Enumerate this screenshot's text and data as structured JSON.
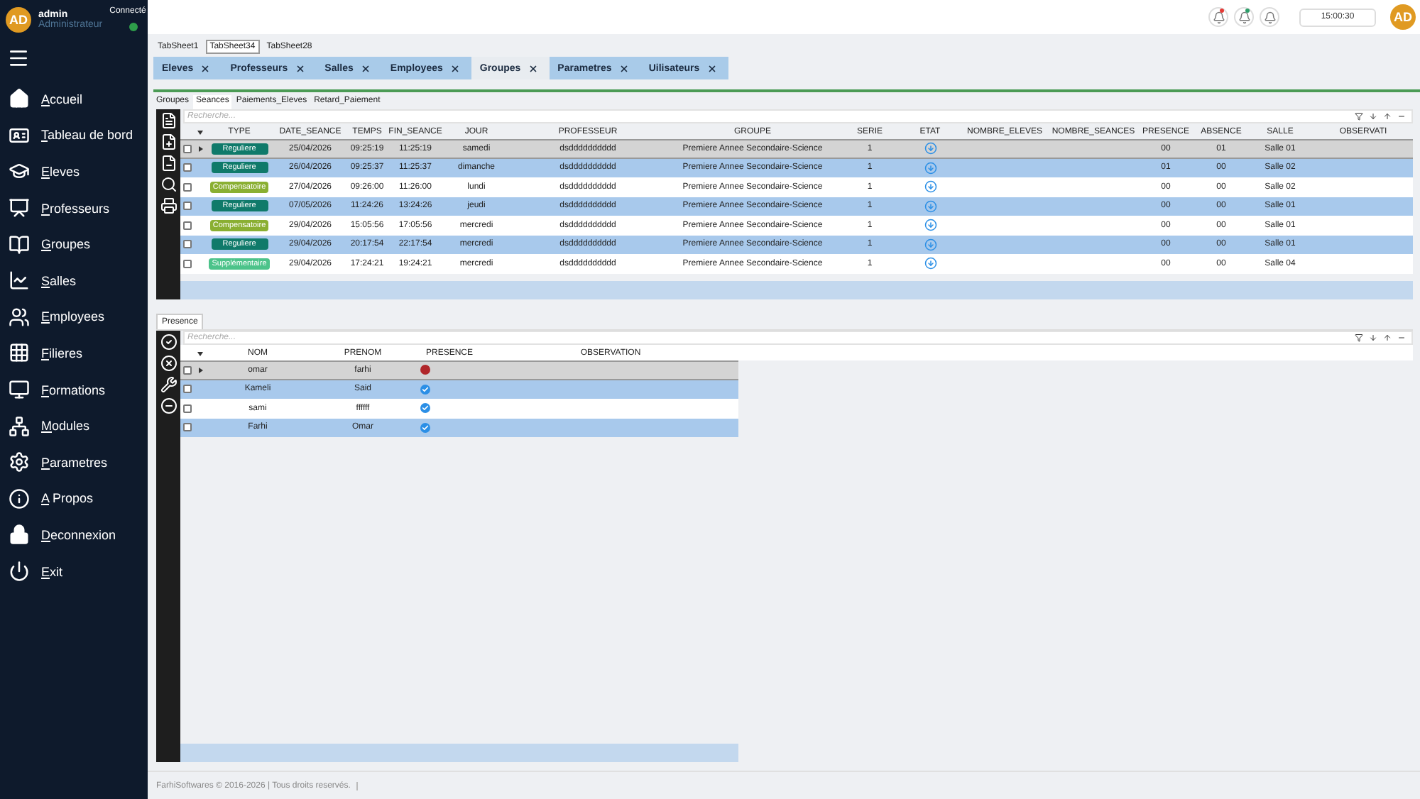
{
  "user": {
    "initials": "AD",
    "name": "admin",
    "role": "Administrateur",
    "status": "Connecté",
    "online": true
  },
  "menu": [
    {
      "label": "Accueil"
    },
    {
      "label": "Tableau de bord"
    },
    {
      "label": "Eleves"
    },
    {
      "label": "Professeurs"
    },
    {
      "label": "Groupes"
    },
    {
      "label": "Salles"
    },
    {
      "label": "Employees"
    },
    {
      "label": "Filieres"
    },
    {
      "label": "Formations"
    },
    {
      "label": "Modules"
    },
    {
      "label": "Parametres"
    },
    {
      "label": "A Propos"
    },
    {
      "label": "Deconnexion"
    },
    {
      "label": "Exit"
    }
  ],
  "topbar": {
    "notifications": [
      {
        "unread": true,
        "color": "#e53935"
      },
      {
        "unread": true,
        "color": "#2e9e6a"
      },
      {
        "unread": false
      }
    ],
    "time": "15:00:30",
    "avatar": "AD"
  },
  "sheet_tabs": [
    {
      "label": "TabSheet1",
      "selected": false
    },
    {
      "label": "TabSheet34",
      "selected": true
    },
    {
      "label": "TabSheet28",
      "selected": false
    }
  ],
  "doc_tabs": [
    {
      "label": "Eleves",
      "selected": false
    },
    {
      "label": "Professeurs",
      "selected": false
    },
    {
      "label": "Salles",
      "selected": false
    },
    {
      "label": "Employees",
      "selected": false
    },
    {
      "label": "Groupes",
      "selected": true
    },
    {
      "label": "Parametres",
      "selected": false
    },
    {
      "label": "Uilisateurs",
      "selected": false
    }
  ],
  "sub_tabs": [
    {
      "label": "Groupes",
      "selected": false
    },
    {
      "label": "Seances",
      "selected": true
    },
    {
      "label": "Paiements_Eleves",
      "selected": false
    },
    {
      "label": "Retard_Paiement",
      "selected": false
    }
  ],
  "seances": {
    "search": {
      "placeholder": "Recherche..."
    },
    "columns": [
      "TYPE",
      "DATE_SEANCE",
      "TEMPS",
      "FIN_SEANCE",
      "JOUR",
      "PROFESSEUR",
      "GROUPE",
      "SERIE",
      "ETAT",
      "NOMBRE_ELEVES",
      "NOMBRE_SEANCES",
      "PRESENCE",
      "ABSENCE",
      "SALLE",
      "OBSERVATI"
    ],
    "rows": [
      {
        "current": true,
        "selected": false,
        "checked": false,
        "type": "Reguliere",
        "color": "#0f7a6a",
        "date": "25/04/2026",
        "temps": "09:25:19",
        "fin": "11:25:19",
        "jour": "samedi",
        "professeur": "dsdddddddddd",
        "groupe": "Premiere Annee Secondaire-Science",
        "serie": "1",
        "presence": "00",
        "absence": "01",
        "salle": "Salle 01"
      },
      {
        "current": false,
        "selected": true,
        "checked": false,
        "type": "Reguliere",
        "color": "#0f7a6a",
        "date": "26/04/2026",
        "temps": "09:25:37",
        "fin": "11:25:37",
        "jour": "dimanche",
        "professeur": "dsdddddddddd",
        "groupe": "Premiere Annee Secondaire-Science",
        "serie": "1",
        "presence": "01",
        "absence": "00",
        "salle": "Salle 02"
      },
      {
        "current": false,
        "selected": false,
        "checked": false,
        "type": "Compensatoire",
        "color": "#8aaf32",
        "date": "27/04/2026",
        "temps": "09:26:00",
        "fin": "11:26:00",
        "jour": "lundi",
        "professeur": "dsdddddddddd",
        "groupe": "Premiere Annee Secondaire-Science",
        "serie": "1",
        "presence": "00",
        "absence": "00",
        "salle": "Salle 02"
      },
      {
        "current": false,
        "selected": true,
        "checked": false,
        "type": "Reguliere",
        "color": "#0f7a6a",
        "date": "07/05/2026",
        "temps": "11:24:26",
        "fin": "13:24:26",
        "jour": "jeudi",
        "professeur": "dsdddddddddd",
        "groupe": "Premiere Annee Secondaire-Science",
        "serie": "1",
        "presence": "00",
        "absence": "00",
        "salle": "Salle 01"
      },
      {
        "current": false,
        "selected": false,
        "checked": false,
        "type": "Compensatoire",
        "color": "#8aaf32",
        "date": "29/04/2026",
        "temps": "15:05:56",
        "fin": "17:05:56",
        "jour": "mercredi",
        "professeur": "dsdddddddddd",
        "groupe": "Premiere Annee Secondaire-Science",
        "serie": "1",
        "presence": "00",
        "absence": "00",
        "salle": "Salle 01"
      },
      {
        "current": false,
        "selected": true,
        "checked": false,
        "type": "Reguliere",
        "color": "#0f7a6a",
        "date": "29/04/2026",
        "temps": "20:17:54",
        "fin": "22:17:54",
        "jour": "mercredi",
        "professeur": "dsdddddddddd",
        "groupe": "Premiere Annee Secondaire-Science",
        "serie": "1",
        "presence": "00",
        "absence": "00",
        "salle": "Salle 01"
      },
      {
        "current": false,
        "selected": false,
        "checked": false,
        "type": "Supplémentaire",
        "color": "#4cc38a",
        "date": "29/04/2026",
        "temps": "17:24:21",
        "fin": "19:24:21",
        "jour": "mercredi",
        "professeur": "dsdddddddddd",
        "groupe": "Premiere Annee Secondaire-Science",
        "serie": "1",
        "presence": "00",
        "absence": "00",
        "salle": "Salle 04"
      }
    ]
  },
  "presence_tab": {
    "label": "Presence",
    "selected": true
  },
  "presence": {
    "search": {
      "placeholder": "Recherche..."
    },
    "columns": [
      "NOM",
      "PRENOM",
      "PRESENCE",
      "OBSERVATION"
    ],
    "rows": [
      {
        "current": true,
        "selected": false,
        "checked": false,
        "nom": "omar",
        "prenom": "farhi",
        "present": false
      },
      {
        "current": false,
        "selected": true,
        "checked": false,
        "nom": "Kameli",
        "prenom": "Said",
        "present": true
      },
      {
        "current": false,
        "selected": false,
        "checked": false,
        "nom": "sami",
        "prenom": "ffffff",
        "present": true
      },
      {
        "current": false,
        "selected": true,
        "checked": false,
        "nom": "Farhi",
        "prenom": "Omar",
        "present": true
      }
    ]
  },
  "status_bar": "FarhiSoftwares © 2016-2026 | Tous droits reservés."
}
